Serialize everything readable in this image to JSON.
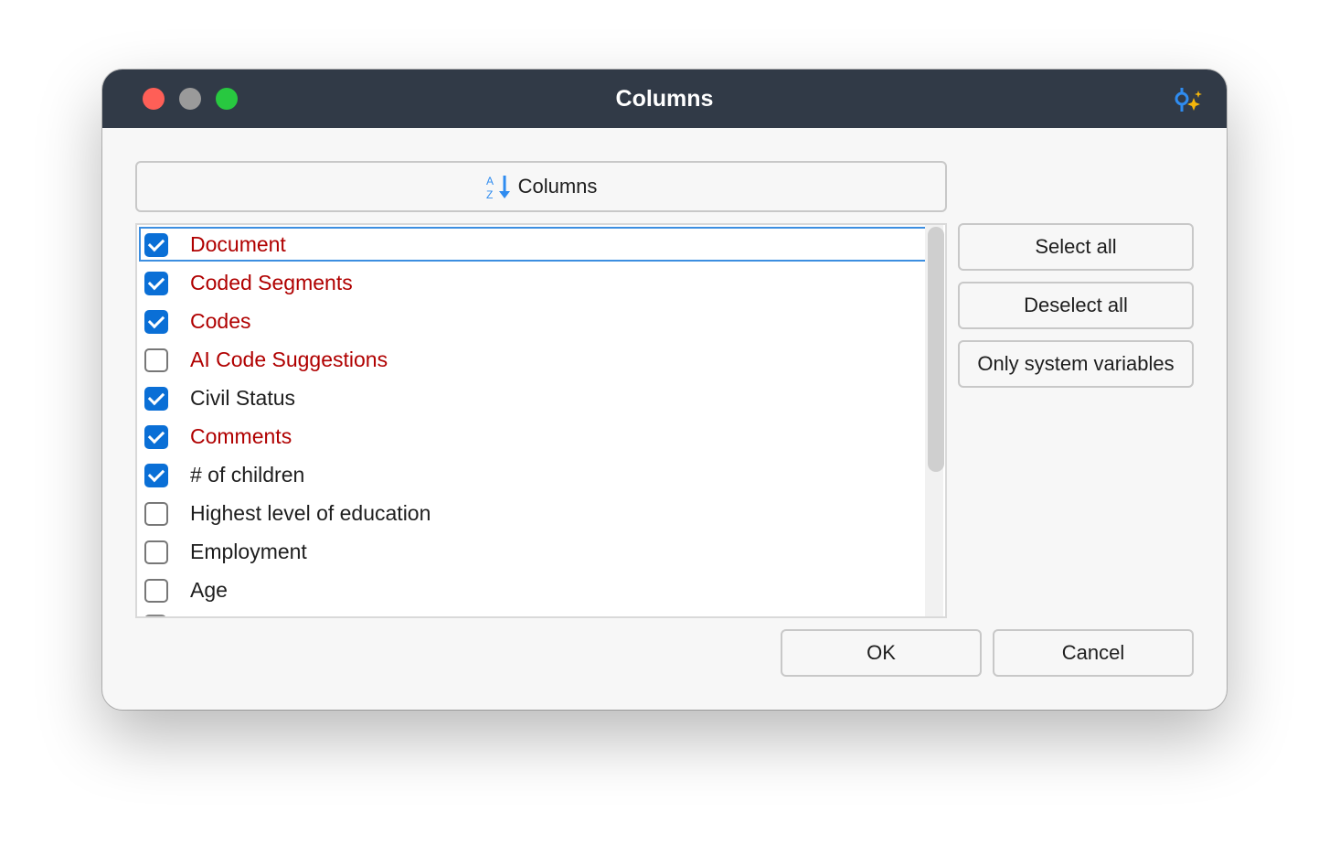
{
  "window": {
    "title": "Columns"
  },
  "sort_button": {
    "label": "Columns"
  },
  "columns": [
    {
      "label": "Document",
      "checked": true,
      "color": "#b00000",
      "focused": true
    },
    {
      "label": "Coded Segments",
      "checked": true,
      "color": "#b00000"
    },
    {
      "label": "Codes",
      "checked": true,
      "color": "#b00000"
    },
    {
      "label": "AI Code Suggestions",
      "checked": false,
      "color": "#b00000"
    },
    {
      "label": "Civil Status",
      "checked": true,
      "color": "#1e1e1e"
    },
    {
      "label": "Comments",
      "checked": true,
      "color": "#b00000"
    },
    {
      "label": "# of children",
      "checked": true,
      "color": "#1e1e1e"
    },
    {
      "label": "Highest level of education",
      "checked": false,
      "color": "#1e1e1e"
    },
    {
      "label": "Employment",
      "checked": false,
      "color": "#1e1e1e"
    },
    {
      "label": "Age",
      "checked": false,
      "color": "#1e1e1e"
    }
  ],
  "side_buttons": {
    "select_all": "Select all",
    "deselect_all": "Deselect all",
    "only_system": "Only system variables"
  },
  "footer": {
    "ok": "OK",
    "cancel": "Cancel"
  },
  "colors": {
    "titlebar": "#313a47",
    "accent": "#0a6fd6",
    "system_variable": "#b00000"
  }
}
